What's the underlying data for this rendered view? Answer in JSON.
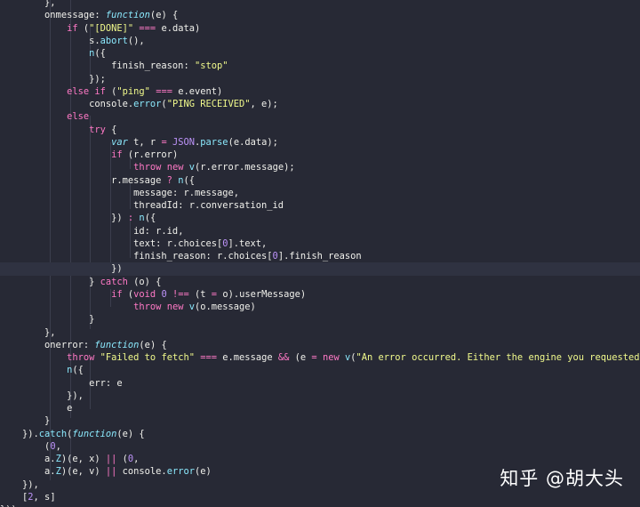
{
  "code": {
    "lines": [
      [
        {
          "t": "        },",
          "c": "pu"
        }
      ],
      [
        {
          "t": "        onmessage",
          "c": "prop"
        },
        {
          "t": ": ",
          "c": "pu"
        },
        {
          "t": "function",
          "c": "fi"
        },
        {
          "t": "(",
          "c": "pu"
        },
        {
          "t": "e",
          "c": "v"
        },
        {
          "t": ") {",
          "c": "pu"
        }
      ],
      [
        {
          "t": "            ",
          "c": "pu"
        },
        {
          "t": "if",
          "c": "k"
        },
        {
          "t": " (",
          "c": "pu"
        },
        {
          "t": "\"[DONE]\"",
          "c": "s"
        },
        {
          "t": " ",
          "c": "pu"
        },
        {
          "t": "===",
          "c": "o"
        },
        {
          "t": " e.data)",
          "c": "pu"
        }
      ],
      [
        {
          "t": "                s.",
          "c": "pu"
        },
        {
          "t": "abort",
          "c": "f"
        },
        {
          "t": "(),",
          "c": "pu"
        }
      ],
      [
        {
          "t": "                ",
          "c": "pu"
        },
        {
          "t": "n",
          "c": "f"
        },
        {
          "t": "({",
          "c": "pu"
        }
      ],
      [
        {
          "t": "                    finish_reason",
          "c": "prop"
        },
        {
          "t": ": ",
          "c": "pu"
        },
        {
          "t": "\"stop\"",
          "c": "s"
        }
      ],
      [
        {
          "t": "                });",
          "c": "pu"
        }
      ],
      [
        {
          "t": "            ",
          "c": "pu"
        },
        {
          "t": "else if",
          "c": "k"
        },
        {
          "t": " (",
          "c": "pu"
        },
        {
          "t": "\"ping\"",
          "c": "s"
        },
        {
          "t": " ",
          "c": "pu"
        },
        {
          "t": "===",
          "c": "o"
        },
        {
          "t": " e.event)",
          "c": "pu"
        }
      ],
      [
        {
          "t": "                console.",
          "c": "pu"
        },
        {
          "t": "error",
          "c": "f"
        },
        {
          "t": "(",
          "c": "pu"
        },
        {
          "t": "\"PING RECEIVED\"",
          "c": "s"
        },
        {
          "t": ", e);",
          "c": "pu"
        }
      ],
      [
        {
          "t": "            ",
          "c": "pu"
        },
        {
          "t": "else",
          "c": "k"
        }
      ],
      [
        {
          "t": "                ",
          "c": "pu"
        },
        {
          "t": "try",
          "c": "k"
        },
        {
          "t": " {",
          "c": "pu"
        }
      ],
      [
        {
          "t": "                    ",
          "c": "pu"
        },
        {
          "t": "var",
          "c": "fi"
        },
        {
          "t": " t, r ",
          "c": "pu"
        },
        {
          "t": "=",
          "c": "o"
        },
        {
          "t": " ",
          "c": "pu"
        },
        {
          "t": "JSON",
          "c": "p"
        },
        {
          "t": ".",
          "c": "pu"
        },
        {
          "t": "parse",
          "c": "f"
        },
        {
          "t": "(e.data);",
          "c": "pu"
        }
      ],
      [
        {
          "t": "                    ",
          "c": "pu"
        },
        {
          "t": "if",
          "c": "k"
        },
        {
          "t": " (r.error)",
          "c": "pu"
        }
      ],
      [
        {
          "t": "                        ",
          "c": "pu"
        },
        {
          "t": "throw",
          "c": "k"
        },
        {
          "t": " ",
          "c": "pu"
        },
        {
          "t": "new",
          "c": "k"
        },
        {
          "t": " ",
          "c": "pu"
        },
        {
          "t": "v",
          "c": "f"
        },
        {
          "t": "(r.error.message);",
          "c": "pu"
        }
      ],
      [
        {
          "t": "                    r.message ",
          "c": "pu"
        },
        {
          "t": "?",
          "c": "o"
        },
        {
          "t": " ",
          "c": "pu"
        },
        {
          "t": "n",
          "c": "f"
        },
        {
          "t": "({",
          "c": "pu"
        }
      ],
      [
        {
          "t": "                        message",
          "c": "prop"
        },
        {
          "t": ": r.message,",
          "c": "pu"
        }
      ],
      [
        {
          "t": "                        threadId",
          "c": "prop"
        },
        {
          "t": ": r.conversation_id",
          "c": "pu"
        }
      ],
      [
        {
          "t": "                    }) ",
          "c": "pu"
        },
        {
          "t": ":",
          "c": "o"
        },
        {
          "t": " ",
          "c": "pu"
        },
        {
          "t": "n",
          "c": "f"
        },
        {
          "t": "({",
          "c": "pu"
        }
      ],
      [
        {
          "t": "                        id",
          "c": "prop"
        },
        {
          "t": ": r.id,",
          "c": "pu"
        }
      ],
      [
        {
          "t": "                        text",
          "c": "prop"
        },
        {
          "t": ": r.choices[",
          "c": "pu"
        },
        {
          "t": "0",
          "c": "n"
        },
        {
          "t": "].text,",
          "c": "pu"
        }
      ],
      [
        {
          "t": "                        finish_reason",
          "c": "prop"
        },
        {
          "t": ": r.choices[",
          "c": "pu"
        },
        {
          "t": "0",
          "c": "n"
        },
        {
          "t": "].finish_reason",
          "c": "pu"
        }
      ],
      [
        {
          "t": "                    })",
          "c": "pu"
        }
      ],
      [
        {
          "t": "                } ",
          "c": "pu"
        },
        {
          "t": "catch",
          "c": "k"
        },
        {
          "t": " (o) {",
          "c": "pu"
        }
      ],
      [
        {
          "t": "                    ",
          "c": "pu"
        },
        {
          "t": "if",
          "c": "k"
        },
        {
          "t": " (",
          "c": "pu"
        },
        {
          "t": "void",
          "c": "k"
        },
        {
          "t": " ",
          "c": "pu"
        },
        {
          "t": "0",
          "c": "n"
        },
        {
          "t": " ",
          "c": "pu"
        },
        {
          "t": "!==",
          "c": "o"
        },
        {
          "t": " (t ",
          "c": "pu"
        },
        {
          "t": "=",
          "c": "o"
        },
        {
          "t": " o).userMessage)",
          "c": "pu"
        }
      ],
      [
        {
          "t": "                        ",
          "c": "pu"
        },
        {
          "t": "throw",
          "c": "k"
        },
        {
          "t": " ",
          "c": "pu"
        },
        {
          "t": "new",
          "c": "k"
        },
        {
          "t": " ",
          "c": "pu"
        },
        {
          "t": "v",
          "c": "f"
        },
        {
          "t": "(o.message)",
          "c": "pu"
        }
      ],
      [
        {
          "t": "                }",
          "c": "pu"
        }
      ],
      [
        {
          "t": "        },",
          "c": "pu"
        }
      ],
      [
        {
          "t": "        onerror",
          "c": "prop"
        },
        {
          "t": ": ",
          "c": "pu"
        },
        {
          "t": "function",
          "c": "fi"
        },
        {
          "t": "(",
          "c": "pu"
        },
        {
          "t": "e",
          "c": "v"
        },
        {
          "t": ") {",
          "c": "pu"
        }
      ],
      [
        {
          "t": "            ",
          "c": "pu"
        },
        {
          "t": "throw",
          "c": "k"
        },
        {
          "t": " ",
          "c": "pu"
        },
        {
          "t": "\"Failed to fetch\"",
          "c": "s"
        },
        {
          "t": " ",
          "c": "pu"
        },
        {
          "t": "===",
          "c": "o"
        },
        {
          "t": " e.message ",
          "c": "pu"
        },
        {
          "t": "&&",
          "c": "o"
        },
        {
          "t": " (e ",
          "c": "pu"
        },
        {
          "t": "=",
          "c": "o"
        },
        {
          "t": " ",
          "c": "pu"
        },
        {
          "t": "new",
          "c": "k"
        },
        {
          "t": " ",
          "c": "pu"
        },
        {
          "t": "v",
          "c": "f"
        },
        {
          "t": "(",
          "c": "pu"
        },
        {
          "t": "\"An error occurred. Either the engine you requested does",
          "c": "s"
        }
      ],
      [
        {
          "t": "            ",
          "c": "pu"
        },
        {
          "t": "n",
          "c": "f"
        },
        {
          "t": "({",
          "c": "pu"
        }
      ],
      [
        {
          "t": "                err",
          "c": "prop"
        },
        {
          "t": ": e",
          "c": "pu"
        }
      ],
      [
        {
          "t": "            }),",
          "c": "pu"
        }
      ],
      [
        {
          "t": "            e",
          "c": "pu"
        }
      ],
      [
        {
          "t": "        }",
          "c": "pu"
        }
      ],
      [
        {
          "t": "    }).",
          "c": "pu"
        },
        {
          "t": "catch",
          "c": "f"
        },
        {
          "t": "(",
          "c": "pu"
        },
        {
          "t": "function",
          "c": "fi"
        },
        {
          "t": "(",
          "c": "pu"
        },
        {
          "t": "e",
          "c": "v"
        },
        {
          "t": ") {",
          "c": "pu"
        }
      ],
      [
        {
          "t": "        (",
          "c": "pu"
        },
        {
          "t": "0",
          "c": "n"
        },
        {
          "t": ",",
          "c": "pu"
        }
      ],
      [
        {
          "t": "        a.",
          "c": "pu"
        },
        {
          "t": "Z",
          "c": "f"
        },
        {
          "t": ")(e, x) ",
          "c": "pu"
        },
        {
          "t": "||",
          "c": "o"
        },
        {
          "t": " (",
          "c": "pu"
        },
        {
          "t": "0",
          "c": "n"
        },
        {
          "t": ",",
          "c": "pu"
        }
      ],
      [
        {
          "t": "        a.",
          "c": "pu"
        },
        {
          "t": "Z",
          "c": "f"
        },
        {
          "t": ")(e, v) ",
          "c": "pu"
        },
        {
          "t": "||",
          "c": "o"
        },
        {
          "t": " console.",
          "c": "pu"
        },
        {
          "t": "error",
          "c": "f"
        },
        {
          "t": "(e)",
          "c": "pu"
        }
      ],
      [
        {
          "t": "    }),",
          "c": "pu"
        }
      ],
      [
        {
          "t": "    [",
          "c": "pu"
        },
        {
          "t": "2",
          "c": "n"
        },
        {
          "t": ", s]",
          "c": "pu"
        }
      ],
      [
        {
          "t": "}))",
          "c": "pu"
        }
      ]
    ],
    "highlighted_line": 21
  },
  "watermark": {
    "text": "知乎 @胡大头"
  },
  "colors": {
    "background": "#272935",
    "keyword": "#ff79c6",
    "string": "#f1fa8c",
    "function": "#8be9fd",
    "number": "#bd93f9"
  }
}
